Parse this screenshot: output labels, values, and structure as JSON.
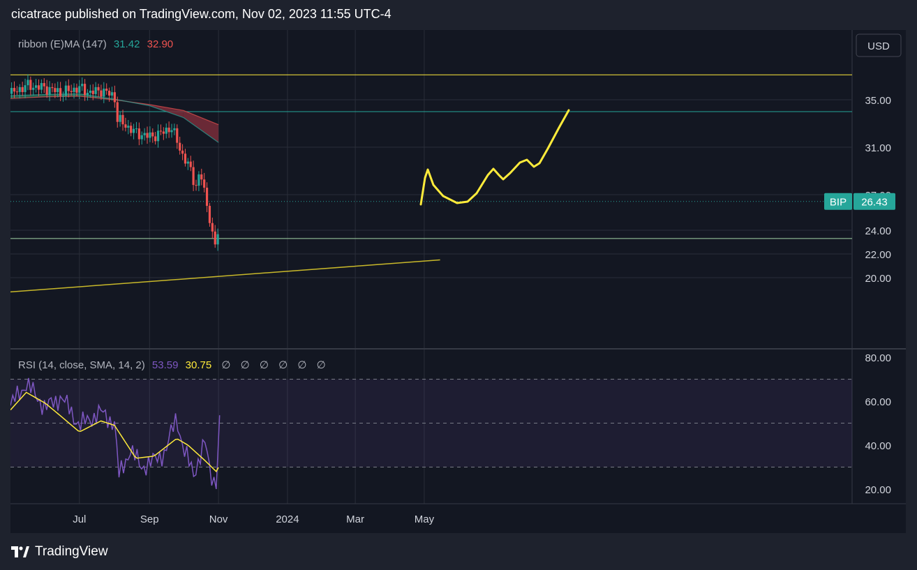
{
  "header": {
    "text": "cicatrace published on TradingView.com, Nov 02, 2023 11:55 UTC-4"
  },
  "footer": {
    "brand": "TradingView",
    "logo_icon": "tradingview-logo-icon"
  },
  "price_pane": {
    "indicator_name": "ribbon (E)MA (147)",
    "indicator_values": [
      "31.42",
      "32.90"
    ],
    "indicator_colors": [
      "#26a69a",
      "#ef5350"
    ],
    "currency_label": "USD",
    "price_axis_labels": [
      "35.00",
      "31.00",
      "27.00",
      "24.00",
      "22.00",
      "20.00"
    ],
    "symbol": "BIP",
    "last_price": "26.43",
    "horizontal_levels": [
      {
        "price": 37.1,
        "color": "#ffeb3b"
      },
      {
        "price": 34.0,
        "color": "#26a69a"
      },
      {
        "price": 23.3,
        "color": "#a5d6a7"
      }
    ],
    "trendline": {
      "from": [
        "2023-05-01",
        18.8
      ],
      "to": [
        "2024-05-15",
        21.5
      ],
      "color": "#c8b82a"
    },
    "projection_color": "#ffeb3b"
  },
  "rsi_pane": {
    "label": "RSI (14, close, SMA, 14, 2)",
    "rsi_value": "53.59",
    "sma_value": "30.75",
    "empty_markers": [
      "∅",
      "∅",
      "∅",
      "∅",
      "∅",
      "∅"
    ],
    "axis_labels": [
      "80.00",
      "60.00",
      "40.00",
      "20.00"
    ],
    "bands": [
      70,
      50,
      30
    ],
    "rsi_color": "#7e57c2",
    "sma_color": "#ffeb3b"
  },
  "time_axis": {
    "labels": [
      "Jul",
      "Sep",
      "Nov",
      "2024",
      "Mar",
      "May"
    ]
  },
  "chart_data": {
    "type": "line",
    "title": "",
    "series": [
      {
        "name": "BIP",
        "x": [
          "2023-05-01",
          "2023-05-15",
          "2023-06-01",
          "2023-06-15",
          "2023-07-01",
          "2023-07-10",
          "2023-07-20",
          "2023-08-01",
          "2023-08-03",
          "2023-08-10",
          "2023-08-20",
          "2023-09-01",
          "2023-09-10",
          "2023-09-20",
          "2023-09-26",
          "2023-10-01",
          "2023-10-06",
          "2023-10-12",
          "2023-10-16",
          "2023-10-20",
          "2023-10-25",
          "2023-10-27",
          "2023-10-30",
          "2023-11-01",
          "2023-11-02"
        ],
        "values": [
          35.5,
          36.2,
          36.0,
          35.6,
          36.0,
          35.6,
          35.8,
          35.3,
          33.4,
          32.9,
          32.2,
          31.9,
          32.1,
          32.7,
          31.4,
          30.1,
          29.4,
          27.7,
          28.9,
          27.0,
          24.7,
          23.2,
          22.4,
          24.5,
          26.4
        ]
      },
      {
        "name": "ribbon (E)MA (147)",
        "x": [
          "2023-05-01",
          "2023-06-01",
          "2023-07-01",
          "2023-08-01",
          "2023-09-01",
          "2023-10-01",
          "2023-11-01"
        ],
        "values": [
          35.1,
          35.25,
          35.3,
          35.0,
          34.6,
          34.1,
          32.9
        ]
      },
      {
        "name": "RSI (14, close, SMA, 14, 2)",
        "x": [
          "2023-05-01",
          "2023-05-15",
          "2023-06-01",
          "2023-06-15",
          "2023-07-01",
          "2023-07-20",
          "2023-08-01",
          "2023-08-05",
          "2023-08-15",
          "2023-08-25",
          "2023-09-05",
          "2023-09-15",
          "2023-09-25",
          "2023-10-01",
          "2023-10-10",
          "2023-10-20",
          "2023-10-25",
          "2023-10-30",
          "2023-11-02"
        ],
        "values": [
          58,
          68,
          57,
          62,
          49,
          55,
          50,
          26,
          38,
          30,
          33,
          37,
          53,
          38,
          27,
          41,
          27,
          22,
          53.59
        ]
      },
      {
        "name": "RSI SMA",
        "x": [
          "2023-05-01",
          "2023-05-15",
          "2023-06-01",
          "2023-06-15",
          "2023-07-01",
          "2023-07-20",
          "2023-08-01",
          "2023-08-20",
          "2023-09-05",
          "2023-09-25",
          "2023-10-05",
          "2023-10-20",
          "2023-10-30",
          "2023-11-02"
        ],
        "values": [
          56,
          64,
          59,
          53,
          46,
          51,
          49,
          34,
          35,
          43,
          40,
          33,
          28,
          30.75
        ]
      }
    ],
    "xlabel": "",
    "ylabel": "",
    "ylim": [
      18.5,
      38
    ]
  }
}
